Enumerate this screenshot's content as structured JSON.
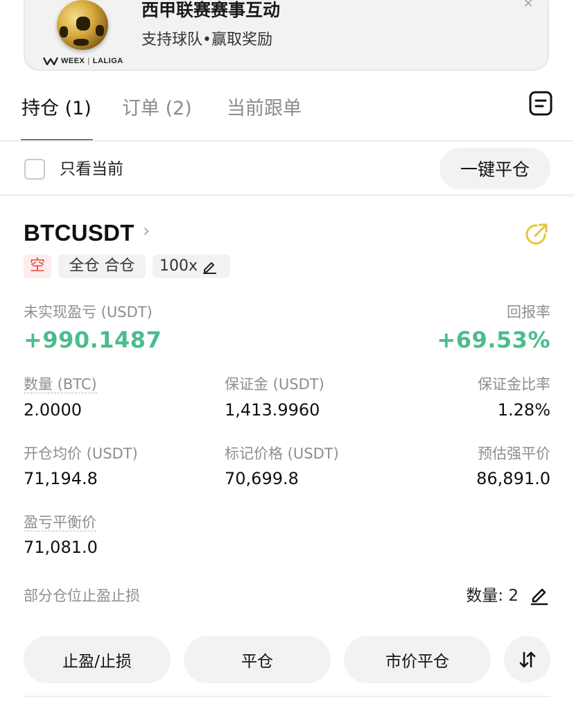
{
  "banner": {
    "brand_left": "WEEX",
    "brand_sep": "|",
    "brand_right": "LALIGA",
    "title": "西甲联赛赛事互动",
    "subtitle": "支持球队•赢取奖励",
    "close_glyph": "×"
  },
  "tabs": [
    {
      "label": "持仓 (1)",
      "active": true
    },
    {
      "label": "订单 (2)",
      "active": false
    },
    {
      "label": "当前跟单",
      "active": false
    }
  ],
  "filter": {
    "only_current_label": "只看当前",
    "close_all_label": "一键平仓"
  },
  "position": {
    "symbol": "BTCUSDT",
    "chevron": "›",
    "side_tag": "空",
    "mode_tag": "全仓 合仓",
    "leverage": "100x",
    "unrealized_pnl_label": "未实现盈亏 (USDT)",
    "unrealized_pnl_value": "+990.1487",
    "roe_label": "回报率",
    "roe_value": "+69.53%",
    "qty_label": "数量 (BTC)",
    "qty_value": "2.0000",
    "margin_label": "保证金 (USDT)",
    "margin_value": "1,413.9960",
    "margin_ratio_label": "保证金比率",
    "margin_ratio_value": "1.28%",
    "entry_label": "开仓均价 (USDT)",
    "entry_value": "71,194.8",
    "mark_label": "标记价格 (USDT)",
    "mark_value": "70,699.8",
    "liq_label": "预估强平价",
    "liq_value": "86,891.0",
    "breakeven_label": "盈亏平衡价",
    "breakeven_value": "71,081.0",
    "partial_tpsl_label": "部分仓位止盈止损",
    "partial_qty": "数量:  2"
  },
  "actions": {
    "tpsl": "止盈/止损",
    "close": "平仓",
    "market_close": "市价平仓"
  },
  "colors": {
    "profit": "#4cbc8d",
    "short": "#e5483f",
    "share_icon": "#e8c53a"
  },
  "icons": [
    "soccer-ball-logo",
    "document-list-icon",
    "share-icon",
    "edit-pencil-icon",
    "swap-arrows-icon"
  ]
}
